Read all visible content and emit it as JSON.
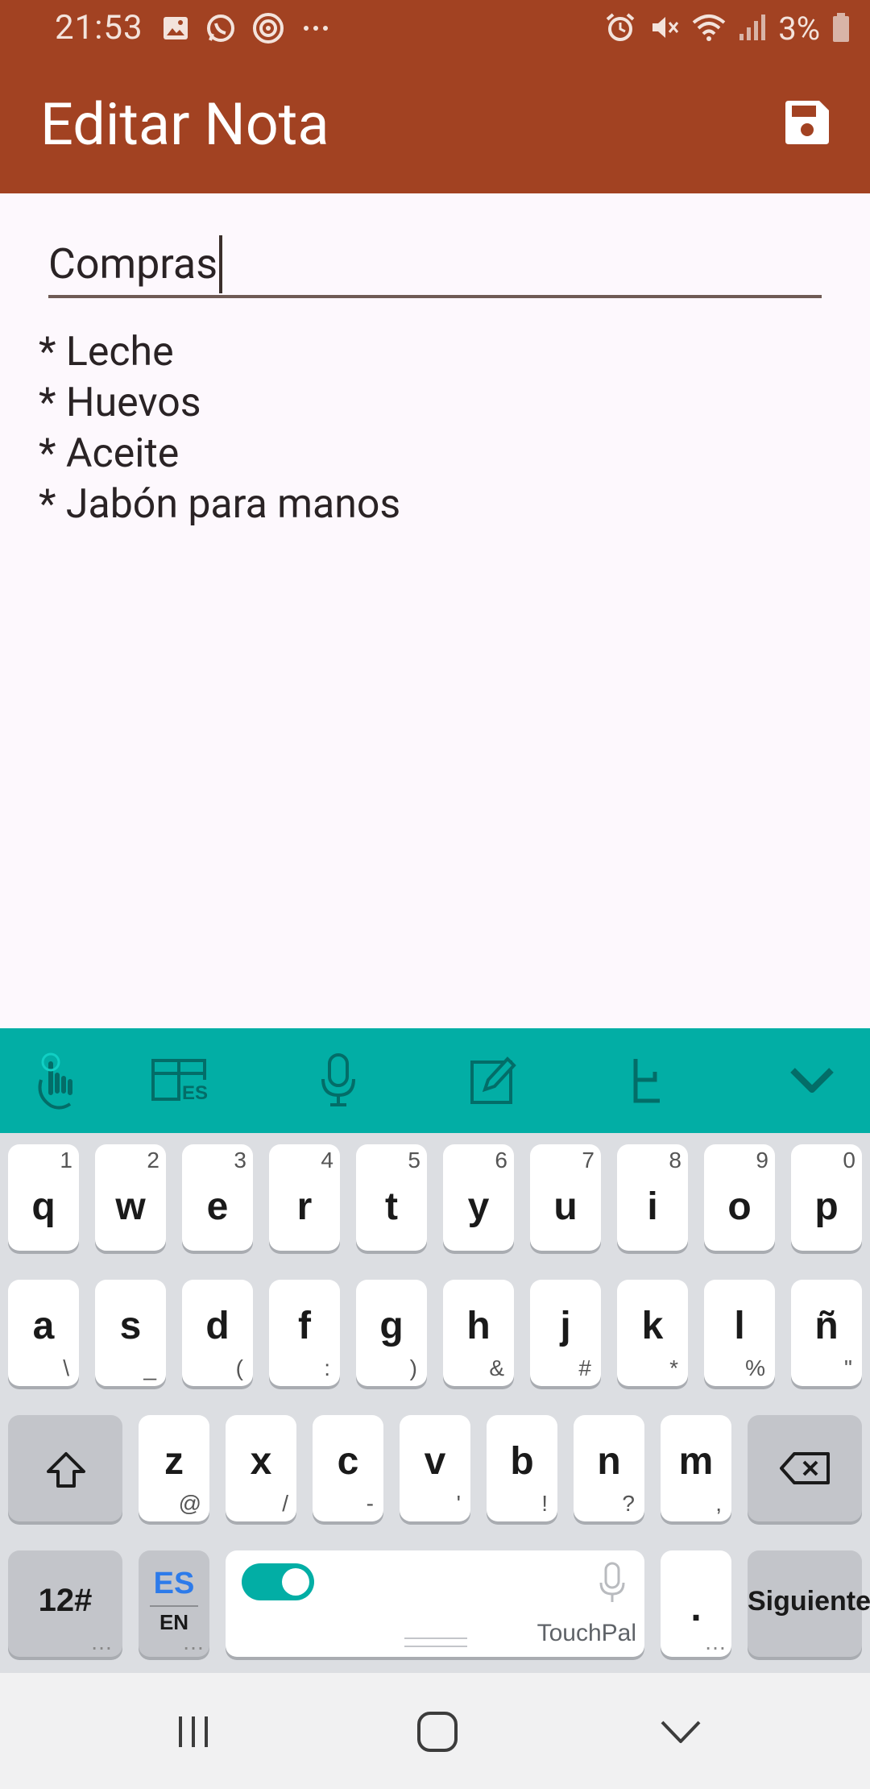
{
  "status_bar": {
    "time": "21:53",
    "battery": "3%",
    "icons_left": [
      "image-icon",
      "whatsapp-icon",
      "target-icon",
      "more-dots-icon"
    ],
    "icons_right": [
      "alarm-icon",
      "mute-icon",
      "wifi-icon",
      "signal-icon",
      "battery-icon"
    ]
  },
  "app_bar": {
    "title": "Editar Nota",
    "save_icon": "save-icon",
    "color": "#a24222"
  },
  "editor": {
    "title_value": "Compras",
    "body_lines": [
      "* Leche",
      "* Huevos",
      "* Aceite",
      "* Jabón para manos"
    ]
  },
  "keyboard": {
    "toolbar_color": "#02aea5",
    "toolbar_icons": [
      "touch-gesture-icon",
      "layout-es-icon",
      "microphone-icon",
      "edit-note-icon",
      "handwriting-icon",
      "collapse-chevron-icon"
    ],
    "row1": [
      {
        "key": "q",
        "hint": "1"
      },
      {
        "key": "w",
        "hint": "2"
      },
      {
        "key": "e",
        "hint": "3"
      },
      {
        "key": "r",
        "hint": "4"
      },
      {
        "key": "t",
        "hint": "5"
      },
      {
        "key": "y",
        "hint": "6"
      },
      {
        "key": "u",
        "hint": "7"
      },
      {
        "key": "i",
        "hint": "8"
      },
      {
        "key": "o",
        "hint": "9"
      },
      {
        "key": "p",
        "hint": "0"
      }
    ],
    "row2": [
      {
        "key": "a",
        "hint": "\\"
      },
      {
        "key": "s",
        "hint": "_"
      },
      {
        "key": "d",
        "hint": "("
      },
      {
        "key": "f",
        "hint": ":"
      },
      {
        "key": "g",
        "hint": ")"
      },
      {
        "key": "h",
        "hint": "&"
      },
      {
        "key": "j",
        "hint": "#"
      },
      {
        "key": "k",
        "hint": "*"
      },
      {
        "key": "l",
        "hint": "%"
      },
      {
        "key": "ñ",
        "hint": "\""
      }
    ],
    "row3": [
      {
        "key": "z",
        "hint": "@"
      },
      {
        "key": "x",
        "hint": "/"
      },
      {
        "key": "c",
        "hint": "-"
      },
      {
        "key": "v",
        "hint": "'"
      },
      {
        "key": "b",
        "hint": "!"
      },
      {
        "key": "n",
        "hint": "?"
      },
      {
        "key": "m",
        "hint": ","
      }
    ],
    "num_key": "12#",
    "lang_primary": "ES",
    "lang_secondary": "EN",
    "space_brand": "TouchPal",
    "period_key": ".",
    "enter_key": "Siguiente",
    "toggle_on": true
  },
  "nav_bar": {
    "icons": [
      "recents-icon",
      "home-icon",
      "back-icon"
    ]
  }
}
